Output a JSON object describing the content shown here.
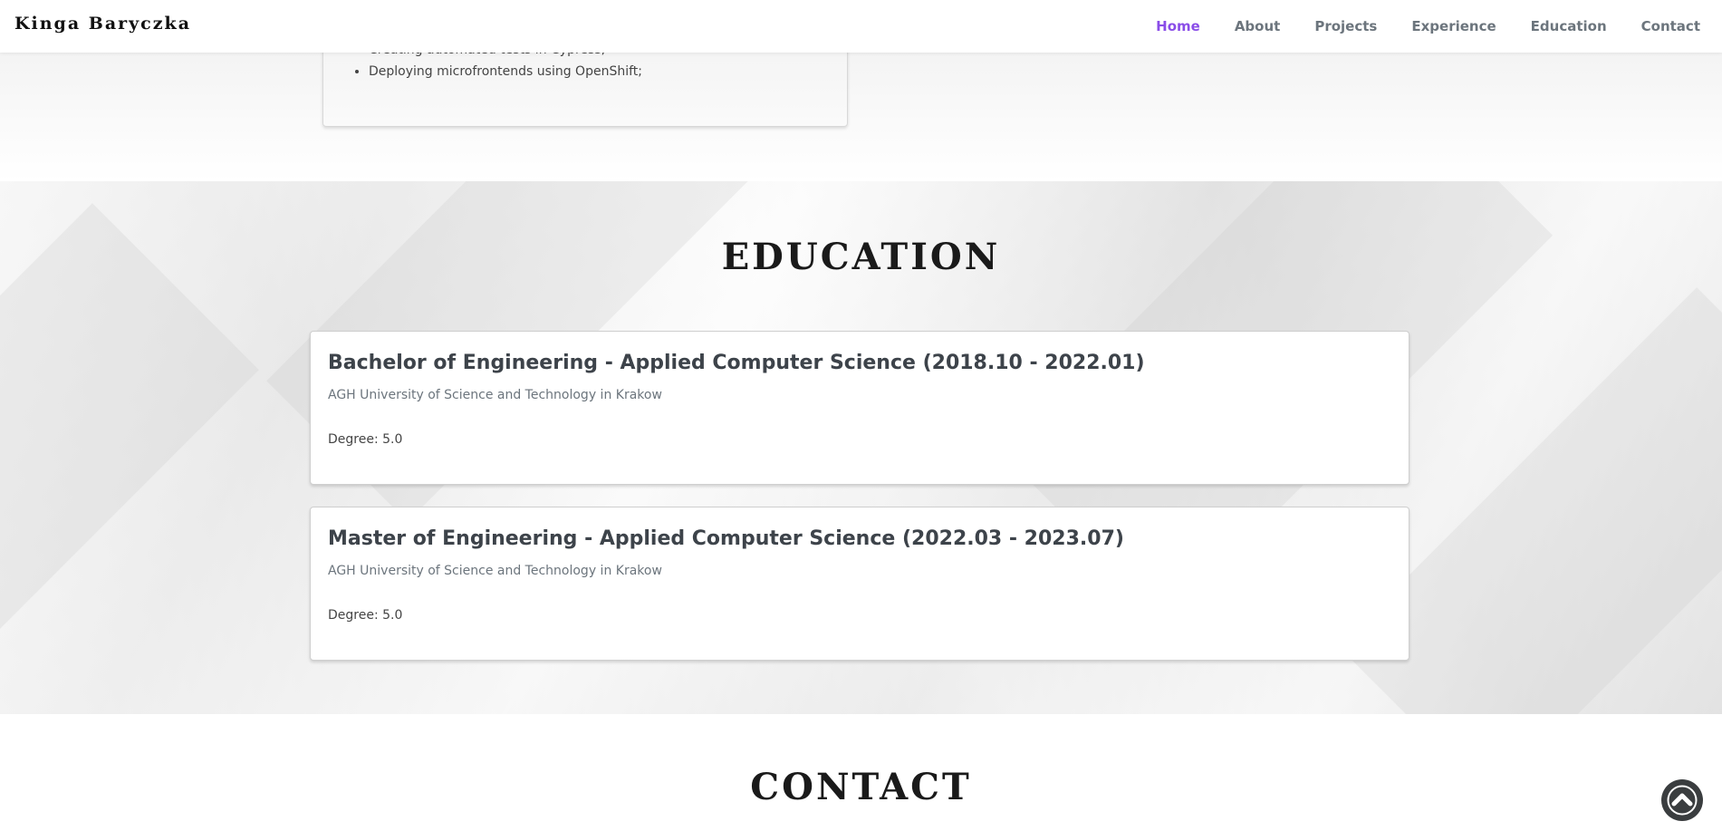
{
  "navbar": {
    "brand": "Kinga Baryczka",
    "links": [
      {
        "label": "Home",
        "active": true
      },
      {
        "label": "About"
      },
      {
        "label": "Projects"
      },
      {
        "label": "Experience"
      },
      {
        "label": "Education"
      },
      {
        "label": "Contact"
      }
    ]
  },
  "experience": {
    "bullets": [
      "Creating automated tests in Cypress;",
      "Deploying microfrontends using OpenShift;"
    ]
  },
  "education": {
    "title": "EDUCATION",
    "entries": [
      {
        "title": "Bachelor of Engineering - Applied Computer Science (2018.10 - 2022.01)",
        "school": "AGH University of Science and Technology in Krakow",
        "degree": "Degree: 5.0"
      },
      {
        "title": "Master of Engineering - Applied Computer Science (2022.03 - 2023.07)",
        "school": "AGH University of Science and Technology in Krakow",
        "degree": "Degree: 5.0"
      }
    ]
  },
  "contact": {
    "title": "CONTACT"
  },
  "colors": {
    "accent": "#8a4de8",
    "nav_text": "#6c757d",
    "scroll_button": "#3a3d3f"
  },
  "icons": {
    "scroll_top": "chevron-up-icon"
  }
}
